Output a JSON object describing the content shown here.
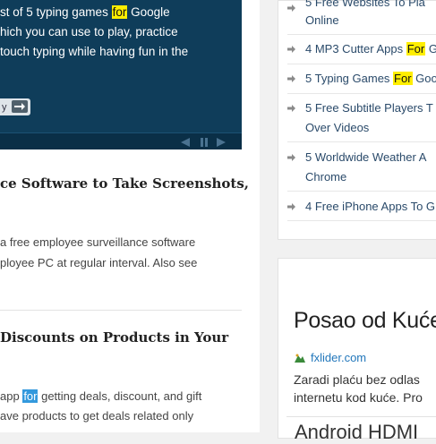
{
  "slider": {
    "lines": [
      {
        "before": "st of 5 typing games ",
        "hl": "for",
        "after": " Google"
      },
      {
        "before": "hich you can use to play, practice",
        "hl": "",
        "after": ""
      },
      {
        "before": "touch typing while having fun in the",
        "hl": "",
        "after": ""
      }
    ],
    "more_label": "y",
    "prev_icon": "triangle-left",
    "pause_icon": "pause",
    "next_icon": "triangle-right"
  },
  "posts": [
    {
      "title_lines": [
        "ce Software to Take Screenshots,",
        ""
      ],
      "text_lines": [
        "a free employee surveillance software",
        "ployee PC at regular interval. Also see"
      ]
    },
    {
      "title_lines": [
        "Discounts on Products in Your"
      ],
      "text_lines": [
        {
          "before": "app ",
          "hl": "for",
          "after": " getting deals, discount, and gift"
        },
        {
          "before": "ave products to get deals related only",
          "hl": "",
          "after": ""
        }
      ]
    }
  ],
  "sidebar": {
    "list": [
      {
        "lines": [
          "5 Free Websites To Pla",
          "Online"
        ]
      },
      {
        "before": "4 MP3 Cutter Apps ",
        "hl": "For",
        "after": " G"
      },
      {
        "before": "5 Typing Games ",
        "hl": "For",
        "after": " Goo"
      },
      {
        "lines": [
          "5 Free Subtitle Players T",
          "Over Videos"
        ]
      },
      {
        "lines": [
          "5 Worldwide Weather A",
          "Chrome"
        ]
      },
      {
        "lines": [
          "4 Free iPhone Apps To G"
        ]
      }
    ],
    "ad": {
      "title": "Posao od Kuće",
      "link": "fxlider.com",
      "text_lines": [
        "Zaradi plaću bez odlas",
        "internetu kod kuće. Pro"
      ],
      "title2": "Android HDMI"
    }
  }
}
